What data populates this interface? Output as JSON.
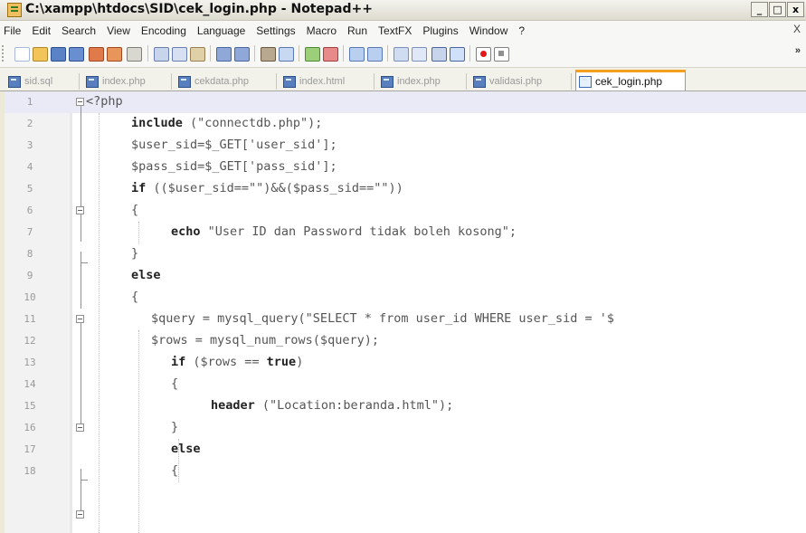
{
  "window": {
    "title": "C:\\xampp\\htdocs\\SID\\cek_login.php - Notepad++",
    "min_label": "_",
    "max_label": "□",
    "close_label": "x"
  },
  "menubar": {
    "items": [
      "File",
      "Edit",
      "Search",
      "View",
      "Encoding",
      "Language",
      "Settings",
      "Macro",
      "Run",
      "TextFX",
      "Plugins",
      "Window",
      "?"
    ],
    "close_label": "X"
  },
  "toolbar": {
    "icons": [
      "new-file-icon",
      "open-file-icon",
      "save-icon",
      "save-all-icon",
      "close-icon",
      "close-all-icon",
      "print-icon",
      "cut-icon",
      "copy-icon",
      "paste-icon",
      "undo-icon",
      "redo-icon",
      "find-icon",
      "replace-icon",
      "zoom-in-icon",
      "zoom-out-icon",
      "sync-vertical-icon",
      "sync-horizontal-icon",
      "word-wrap-icon",
      "show-all-chars-icon",
      "indent-guide-icon",
      "user-lang-icon",
      "record-macro-icon",
      "stop-record-icon"
    ],
    "more_label": "»"
  },
  "tabs": [
    {
      "label": "sid.sql",
      "active": false
    },
    {
      "label": "index.php",
      "active": false
    },
    {
      "label": "cekdata.php",
      "active": false
    },
    {
      "label": "index.html",
      "active": false
    },
    {
      "label": "index.php",
      "active": false
    },
    {
      "label": "validasi.php",
      "active": false
    },
    {
      "label": "cek_login.php",
      "active": true
    }
  ],
  "code_lines": [
    {
      "n": "1",
      "text": "<?php"
    },
    {
      "n": "2",
      "text": "include (\"connectdb.php\");"
    },
    {
      "n": "3",
      "text": "$user_sid=$_GET['user_sid'];"
    },
    {
      "n": "4",
      "text": "$pass_sid=$_GET['pass_sid'];"
    },
    {
      "n": "5",
      "text": "if (($user_sid==\"\")&&($pass_sid==\"\"))"
    },
    {
      "n": "6",
      "text": "{"
    },
    {
      "n": "7",
      "text": "echo \"User ID dan Password tidak boleh kosong\";"
    },
    {
      "n": "8",
      "text": "}"
    },
    {
      "n": "9",
      "text": "else"
    },
    {
      "n": "10",
      "text": "{"
    },
    {
      "n": "11",
      "text": "$query = mysql_query(\"SELECT * from user_id WHERE user_sid = '$"
    },
    {
      "n": "12",
      "text": "$rows = mysql_num_rows($query);"
    },
    {
      "n": "13",
      "text": "if ($rows == true)"
    },
    {
      "n": "14",
      "text": "{"
    },
    {
      "n": "15",
      "text": "header (\"Location:beranda.html\");"
    },
    {
      "n": "16",
      "text": "}"
    },
    {
      "n": "17",
      "text": "else"
    },
    {
      "n": "18",
      "text": "{"
    }
  ],
  "colors": {
    "active_tab_accent": "#f4a01c",
    "current_line": "#eaeaf6",
    "tag_color": "#800000"
  }
}
